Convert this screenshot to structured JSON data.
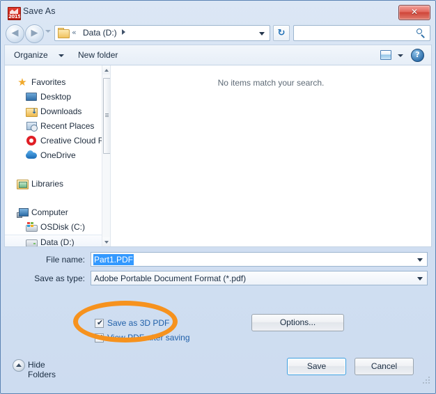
{
  "window": {
    "title": "Save As",
    "icon": "solidworks-2015-icon",
    "icon_year": "2015",
    "close_label": "✕"
  },
  "nav": {
    "back_label": "◀",
    "forward_label": "▶",
    "recent_dropdown": "chevron-down-icon",
    "address": {
      "chevron": "«",
      "crumb": "Data (D:)",
      "dropdown": "chevron-down-icon"
    },
    "refresh_label": "↻",
    "search": {
      "value": "",
      "placeholder": ""
    }
  },
  "command_bar": {
    "organize": "Organize",
    "new_folder": "New folder",
    "view_icon": "view-layout-icon",
    "view_dropdown": "chevron-down-icon",
    "help": "?"
  },
  "sidebar": {
    "items": [
      {
        "label": "Favorites",
        "icon": "star-icon",
        "level": 0,
        "selected": false
      },
      {
        "label": "Desktop",
        "icon": "desktop-icon",
        "level": 1,
        "selected": false
      },
      {
        "label": "Downloads",
        "icon": "downloads-icon",
        "level": 1,
        "selected": false
      },
      {
        "label": "Recent Places",
        "icon": "recent-places-icon",
        "level": 1,
        "selected": false
      },
      {
        "label": "Creative Cloud Fi",
        "icon": "creative-cloud-icon",
        "level": 1,
        "selected": false
      },
      {
        "label": "OneDrive",
        "icon": "onedrive-icon",
        "level": 1,
        "selected": false
      },
      {
        "label": "Libraries",
        "icon": "libraries-icon",
        "level": 0,
        "selected": false
      },
      {
        "label": "Computer",
        "icon": "computer-icon",
        "level": 0,
        "selected": false
      },
      {
        "label": "OSDisk (C:)",
        "icon": "system-drive-icon",
        "level": 1,
        "selected": false
      },
      {
        "label": "Data (D:)",
        "icon": "drive-icon",
        "level": 1,
        "selected": true
      }
    ],
    "scrollbar": {
      "up_arrow": "scroll-up-icon",
      "down_arrow": "scroll-down-icon"
    }
  },
  "file_list": {
    "empty_message": "No items match your search."
  },
  "form": {
    "file_name_label": "File name:",
    "file_name_value": "Part1.PDF",
    "save_as_type_label": "Save as type:",
    "save_as_type_value": "Adobe Portable Document Format (*.pdf)"
  },
  "options": {
    "save_3d_pdf": {
      "label": "Save as 3D PDF",
      "checked": true,
      "mark": "✔"
    },
    "view_after_saving": {
      "label": "View PDF after saving",
      "checked": true,
      "mark": "✔"
    },
    "options_button": "Options..."
  },
  "footer": {
    "hide_folders": "Hide Folders",
    "save_button": "Save",
    "cancel_button": "Cancel"
  },
  "annotation": {
    "shape": "ellipse-highlight",
    "color": "#f6921e"
  },
  "colors": {
    "accent": "#3399ff",
    "annotation_orange": "#f6921e",
    "link_blue": "#1f5fa8",
    "frame_border": "#5b83b3"
  }
}
